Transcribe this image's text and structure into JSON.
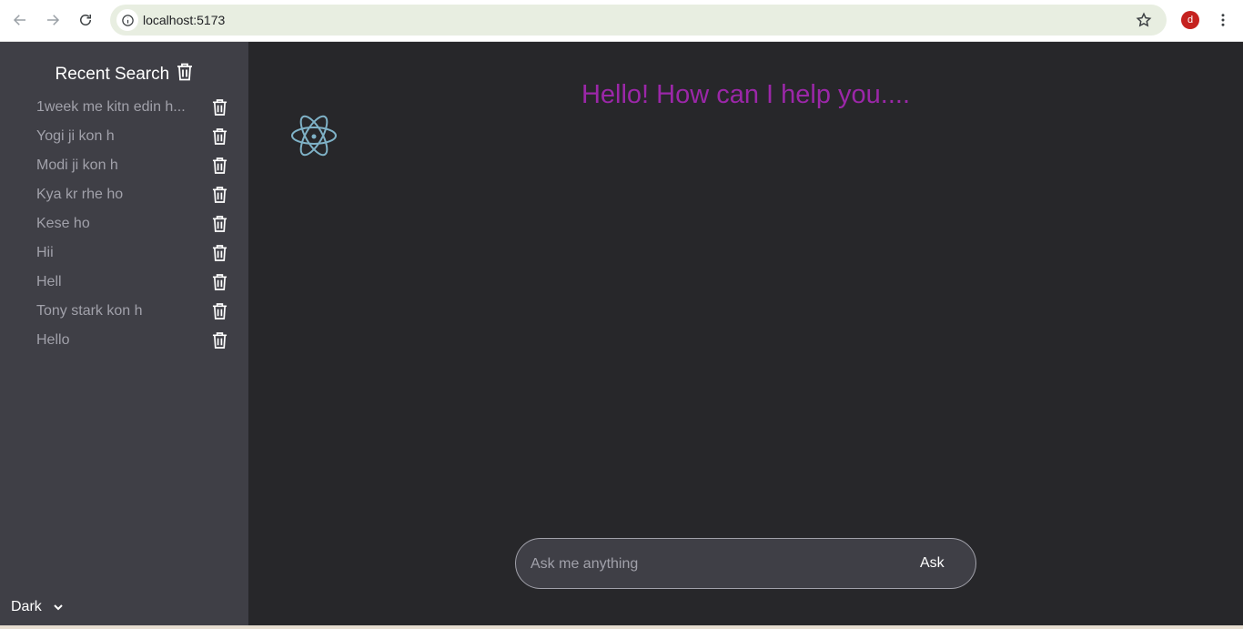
{
  "browser": {
    "url": "localhost:5173",
    "avatar_letter": "d"
  },
  "sidebar": {
    "title": "Recent Search",
    "items": [
      {
        "label": "1week me kitn edin h..."
      },
      {
        "label": "Yogi ji kon h"
      },
      {
        "label": "Modi ji kon h"
      },
      {
        "label": "Kya kr rhe ho"
      },
      {
        "label": "Kese ho"
      },
      {
        "label": "Hii"
      },
      {
        "label": "Hell"
      },
      {
        "label": "Tony stark kon h"
      },
      {
        "label": "Hello"
      }
    ],
    "theme": "Dark"
  },
  "main": {
    "greeting": "Hello! How can I help you....",
    "ask_placeholder": "Ask me anything",
    "ask_label": "Ask"
  },
  "colors": {
    "greeting": "#9b27a8",
    "sidebar_bg": "#3f3f46",
    "main_bg": "#27272a"
  }
}
